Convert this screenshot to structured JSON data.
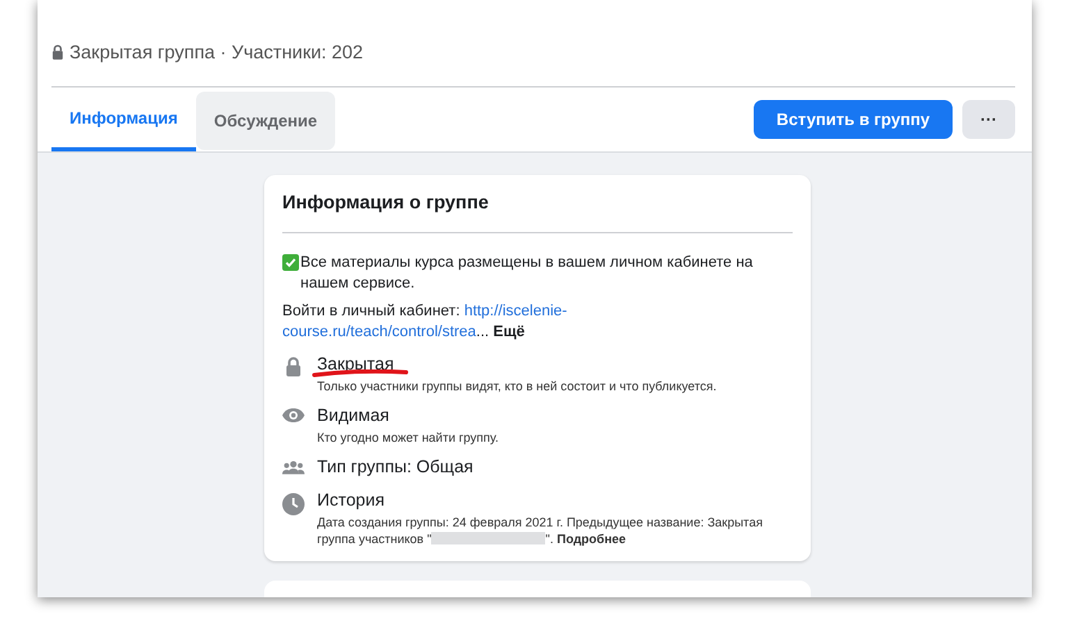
{
  "header": {
    "subtitle": "Закрытая группа · Участники: 202"
  },
  "tabs": [
    {
      "label": "Информация",
      "selected": true
    },
    {
      "label": "Обсуждение",
      "selected": false
    }
  ],
  "join_button": "Вступить в группу",
  "more_button": "···",
  "about": {
    "title": "Информация о группе",
    "description": "Все материалы курса размещены в вашем личном кабинете на нашем сервисе.",
    "login_label": "Войти в личный кабинет:",
    "link_part1": "http://iscelenie-",
    "link_part2": "course.ru/teach/control/strea",
    "ellipsis": "...",
    "see_more": "Ещё",
    "items": [
      {
        "title": "Закрытая",
        "text": "Только участники группы видят, кто в ней состоит и что публикуется.",
        "underlined": true
      },
      {
        "title": "Видимая",
        "text": "Кто угодно может найти группу.",
        "underlined": false
      },
      {
        "title": "Тип группы: Общая",
        "underlined": false
      },
      {
        "title": "История",
        "text": "Дата создания группы: 24 февраля 2021 г. Предыдущее название: Закрытая группа участников \"",
        "redacted": true,
        "text_after": "\". ",
        "link": "Подробнее",
        "underlined": false
      }
    ]
  }
}
